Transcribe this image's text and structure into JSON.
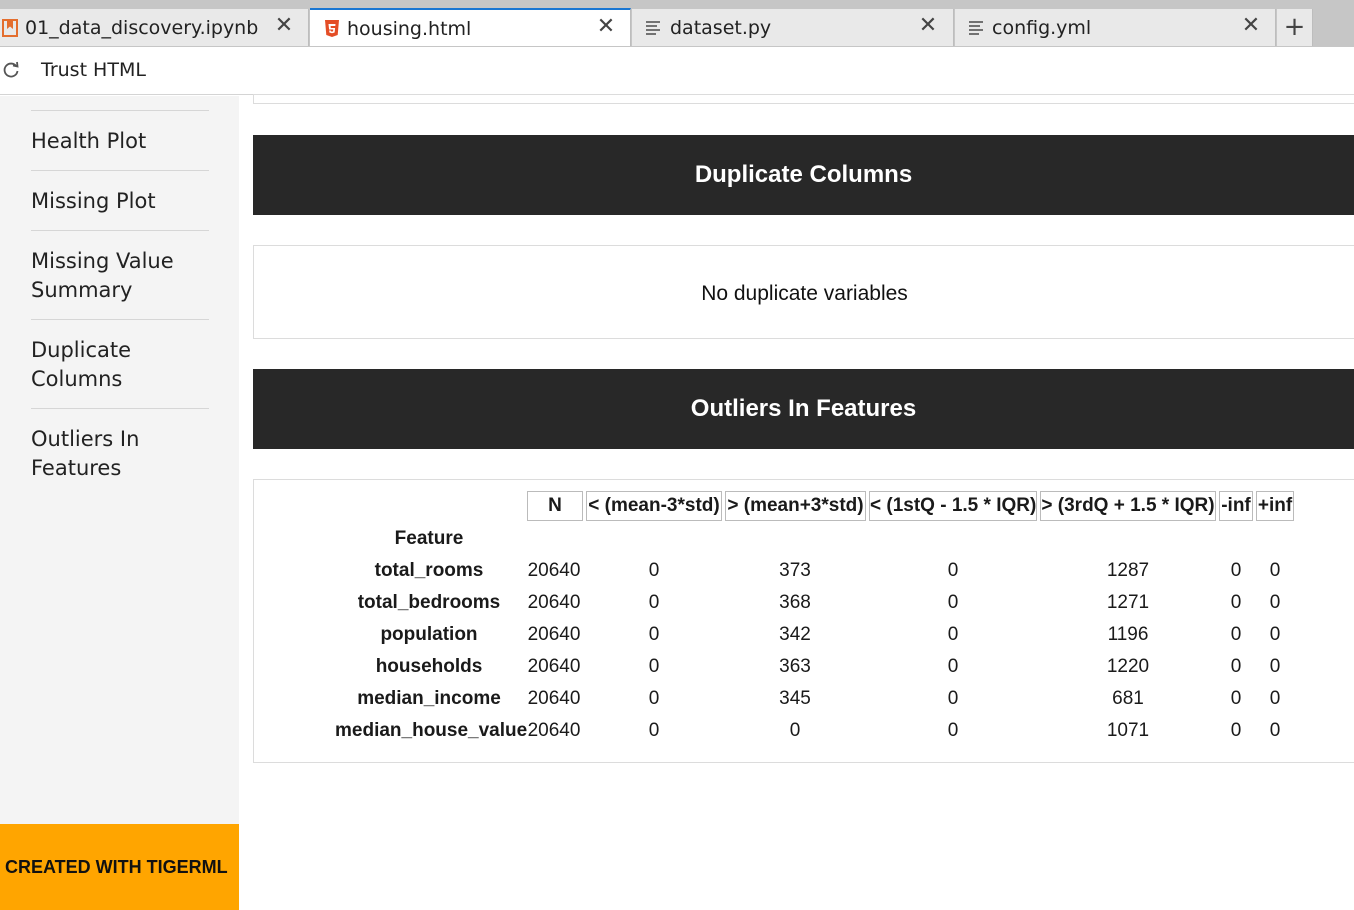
{
  "tabs": [
    {
      "label": "01_data_discovery.ipynb",
      "icon": "notebook-icon",
      "active": false
    },
    {
      "label": "housing.html",
      "icon": "html5-icon",
      "active": true
    },
    {
      "label": "dataset.py",
      "icon": "file-text-icon",
      "active": false
    },
    {
      "label": "config.yml",
      "icon": "file-text-icon",
      "active": false
    }
  ],
  "toolbar": {
    "trust_label": "Trust HTML"
  },
  "sidebar": {
    "items": [
      {
        "label": "Health Plot"
      },
      {
        "label": "Missing Plot"
      },
      {
        "label": "Missing Value Summary"
      },
      {
        "label": "Duplicate Columns"
      },
      {
        "label": "Outliers In Features"
      }
    ],
    "footer": "CREATED WITH TIGERML"
  },
  "sections": {
    "duplicate_title": "Duplicate Columns",
    "duplicate_message": "No duplicate variables",
    "outliers_title": "Outliers In Features"
  },
  "table": {
    "index_header": "Feature",
    "columns": [
      "N",
      "< (mean-3*std)",
      "> (mean+3*std)",
      "< (1stQ - 1.5 * IQR)",
      "> (3rdQ + 1.5 * IQR)",
      "-inf",
      "+inf"
    ],
    "rows": [
      {
        "feature": "total_rooms",
        "values": [
          "20640",
          "0",
          "373",
          "0",
          "1287",
          "0",
          "0"
        ]
      },
      {
        "feature": "total_bedrooms",
        "values": [
          "20640",
          "0",
          "368",
          "0",
          "1271",
          "0",
          "0"
        ]
      },
      {
        "feature": "population",
        "values": [
          "20640",
          "0",
          "342",
          "0",
          "1196",
          "0",
          "0"
        ]
      },
      {
        "feature": "households",
        "values": [
          "20640",
          "0",
          "363",
          "0",
          "1220",
          "0",
          "0"
        ]
      },
      {
        "feature": "median_income",
        "values": [
          "20640",
          "0",
          "345",
          "0",
          "681",
          "0",
          "0"
        ]
      },
      {
        "feature": "median_house_value",
        "values": [
          "20640",
          "0",
          "0",
          "0",
          "1071",
          "0",
          "0"
        ]
      }
    ]
  },
  "colors": {
    "accent": "#1976d2",
    "header_bg": "#282828",
    "badge_bg": "#ffa500",
    "sidebar_bg": "#f4f4f4"
  }
}
